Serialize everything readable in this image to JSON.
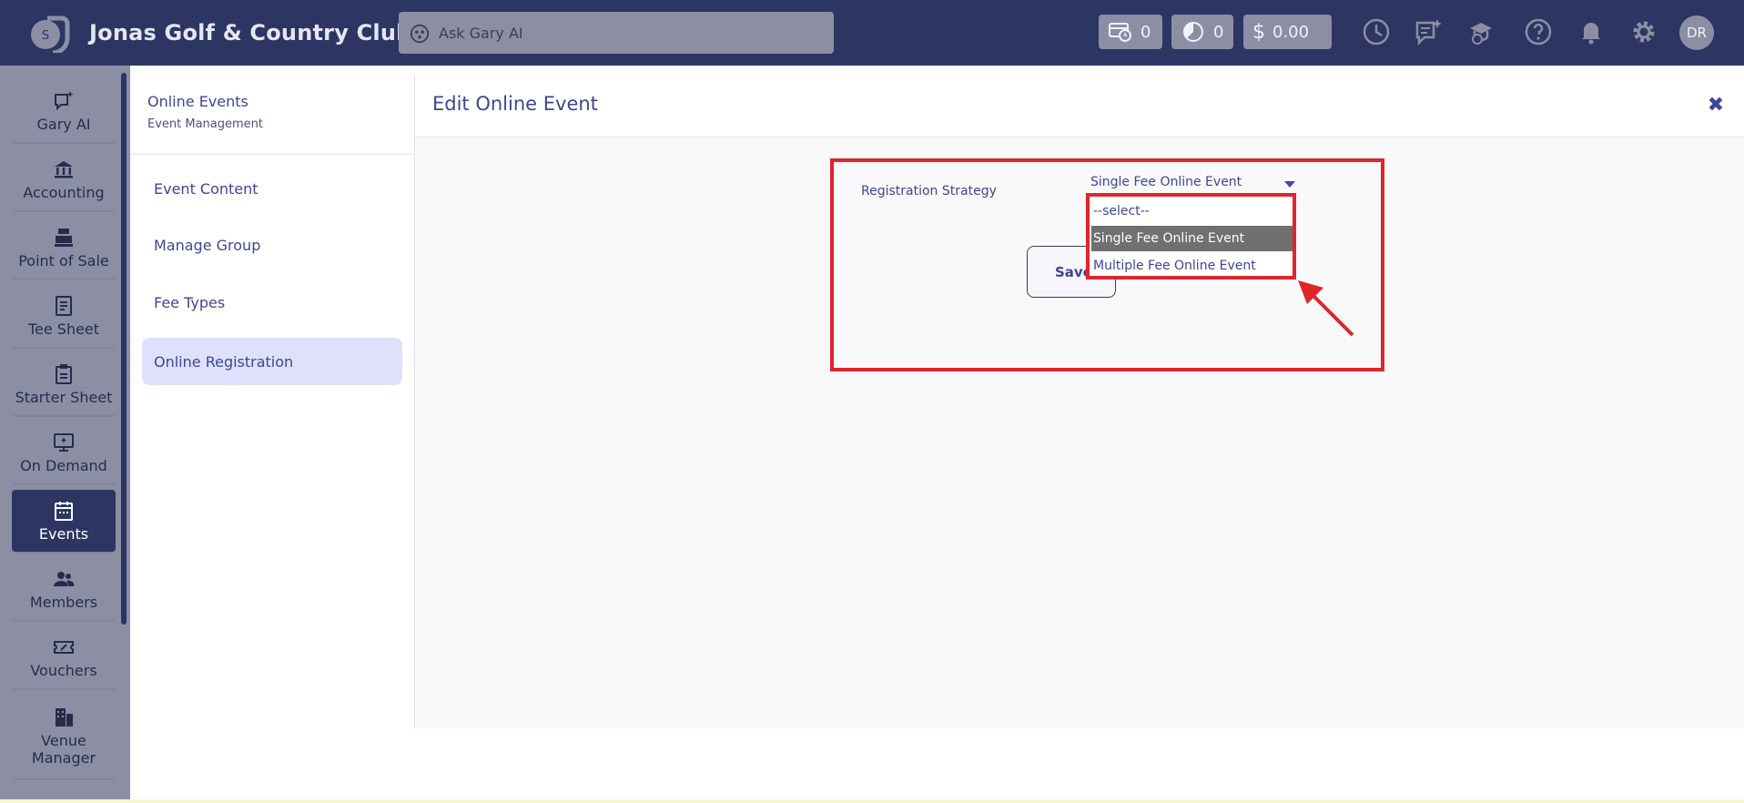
{
  "app": {
    "club_name": "Jonas Golf & Country Club",
    "logo_letter": "S"
  },
  "search": {
    "placeholder": "Ask Gary AI"
  },
  "counters": {
    "tee_time_count": "0",
    "timer_count": "0",
    "balance": "0.00"
  },
  "user": {
    "initials": "DR"
  },
  "left_nav": {
    "items": [
      {
        "label": "Gary AI",
        "icon": "chat-sparkle-icon"
      },
      {
        "label": "Accounting",
        "icon": "bank-icon"
      },
      {
        "label": "Point of Sale",
        "icon": "register-icon"
      },
      {
        "label": "Tee Sheet",
        "icon": "document-icon"
      },
      {
        "label": "Starter Sheet",
        "icon": "clipboard-icon"
      },
      {
        "label": "On Demand",
        "icon": "monitor-icon"
      },
      {
        "label": "Events",
        "icon": "calendar-icon"
      },
      {
        "label": "Members",
        "icon": "people-icon"
      },
      {
        "label": "Vouchers",
        "icon": "ticket-icon"
      },
      {
        "label": "Venue Manager",
        "icon": "building-icon"
      }
    ],
    "active": "Events"
  },
  "sub_nav": {
    "title": "Online Events",
    "subtitle": "Event Management",
    "items": [
      {
        "label": "Event Content"
      },
      {
        "label": "Manage Group"
      },
      {
        "label": "Fee Types"
      },
      {
        "label": "Online Registration"
      }
    ],
    "active": "Online Registration"
  },
  "main": {
    "title": "Edit Online Event",
    "form": {
      "registration_strategy_label": "Registration Strategy",
      "registration_strategy_value": "Single Fee Online Event",
      "options": [
        "--select--",
        "Single Fee Online Event",
        "Multiple Fee Online Event"
      ],
      "selected_index": 1,
      "save_label": "Save"
    }
  },
  "colors": {
    "topbar": "#2d3562",
    "muted": "#8c8fa4",
    "accent_text": "#3d4694",
    "active_subnav": "#dfe0fb",
    "highlight": "#e0242b"
  }
}
